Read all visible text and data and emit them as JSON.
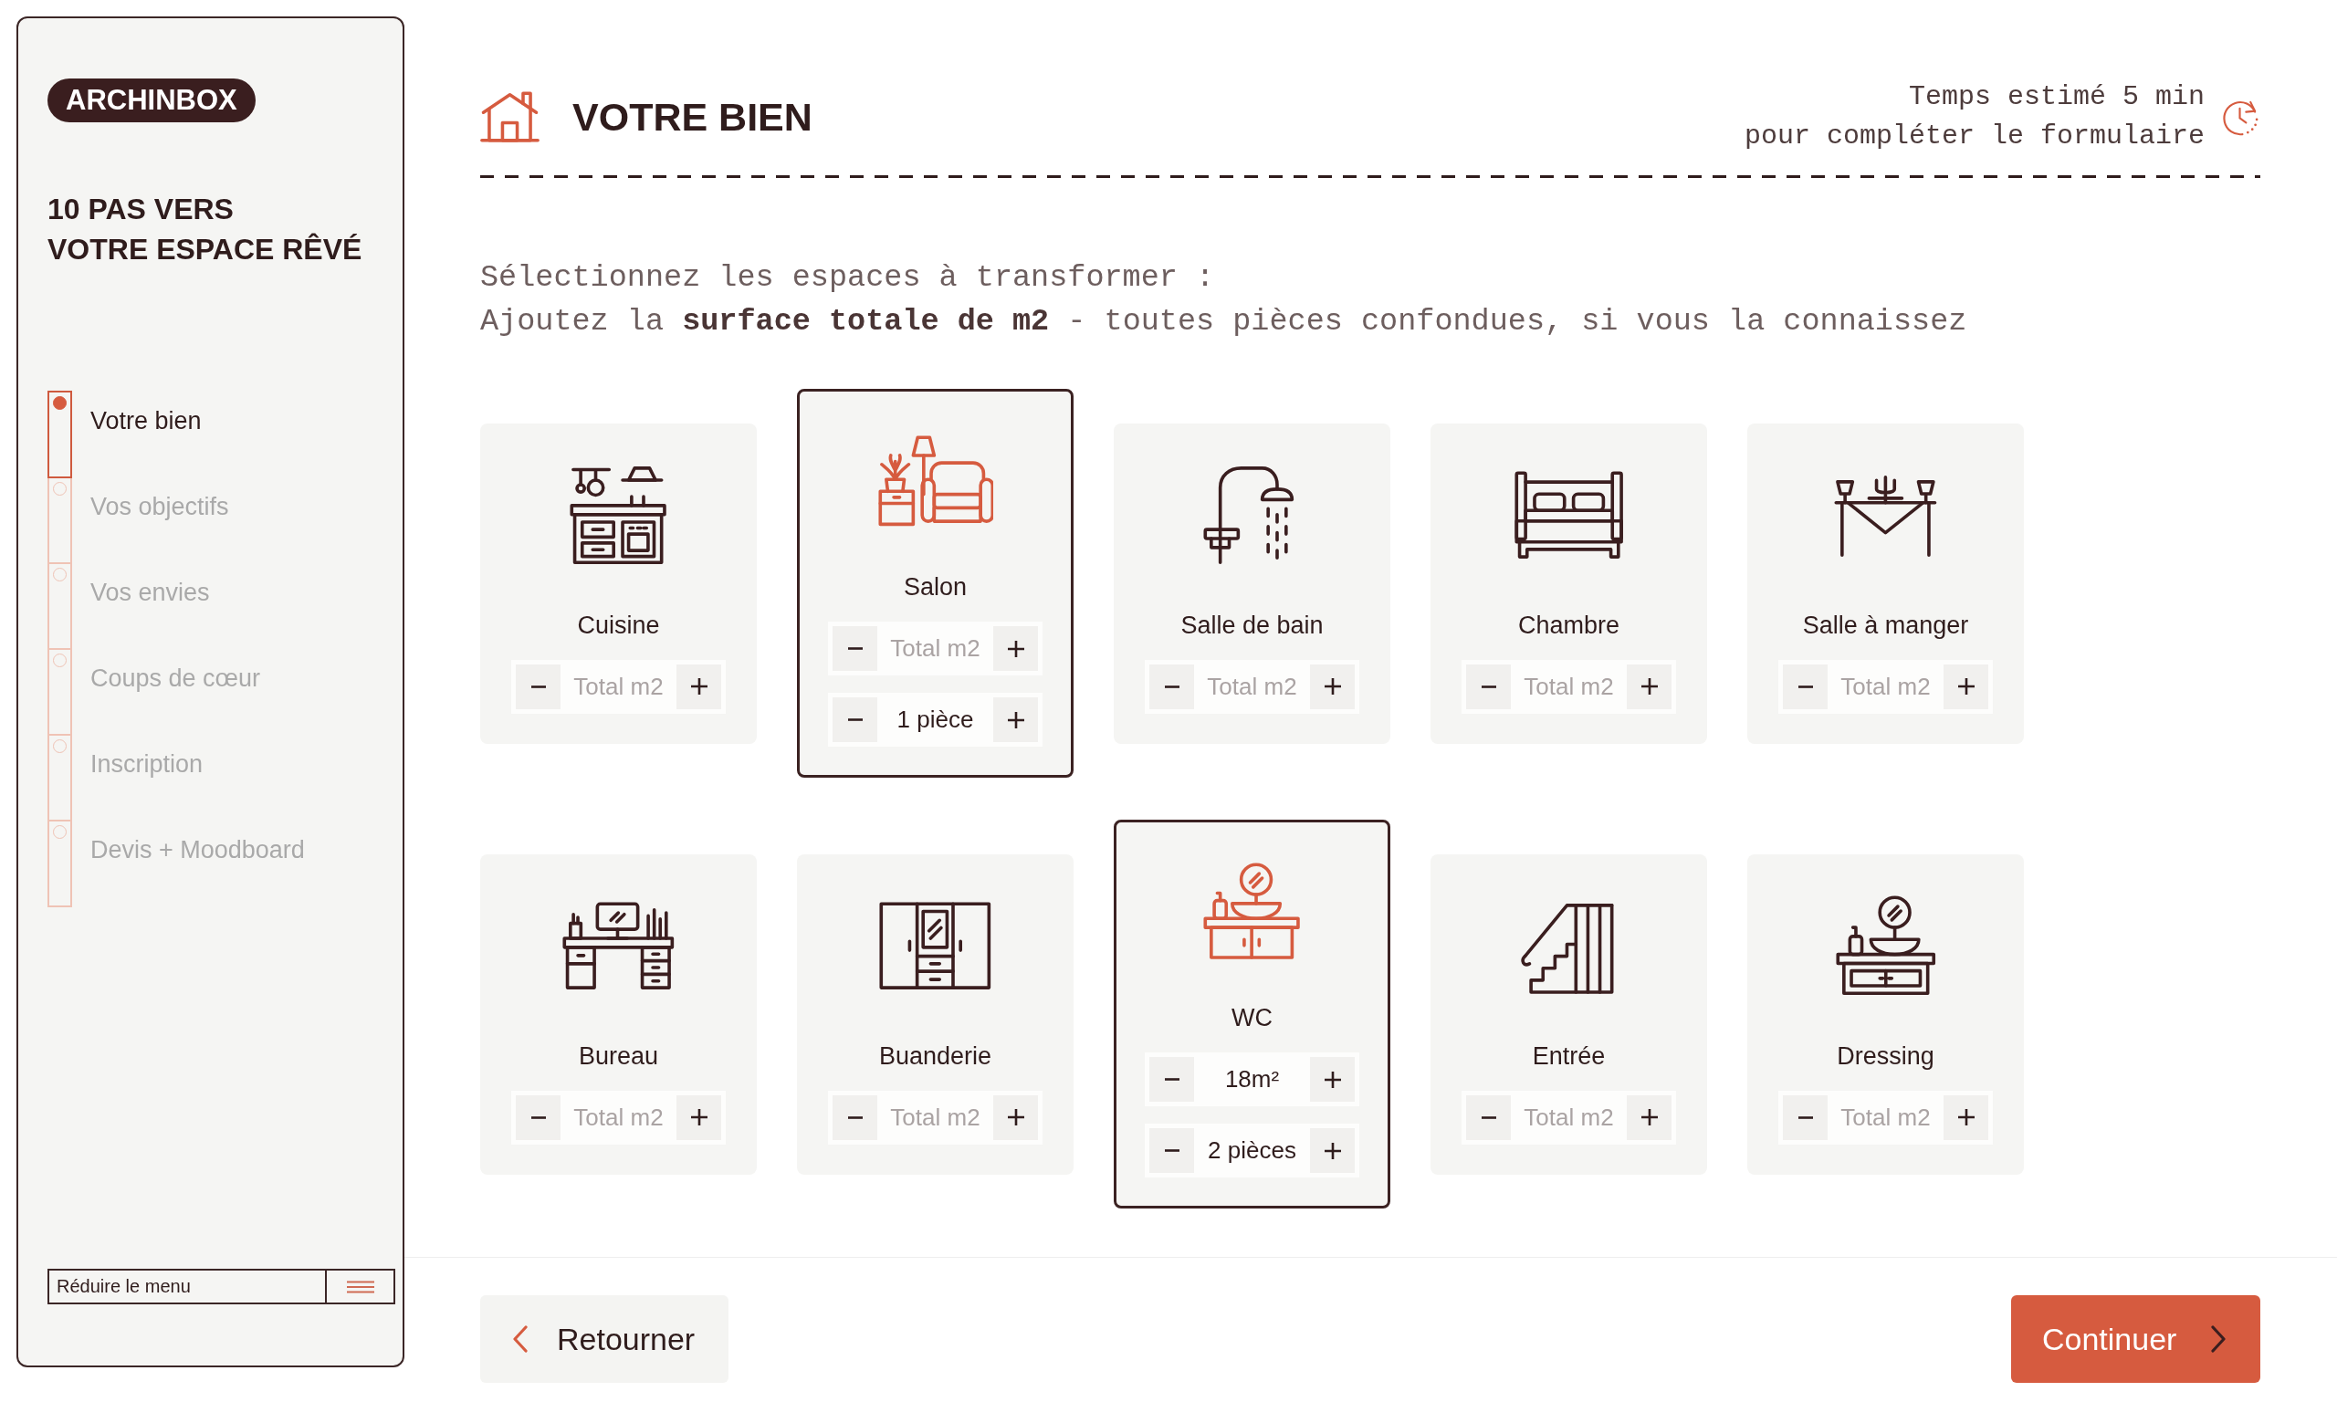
{
  "sidebar": {
    "logo": "ARCHINBOX",
    "heading_lines": [
      "10 PAS VERS",
      "VOTRE ESPACE RÊVÉ"
    ],
    "steps": [
      {
        "label": "Votre bien",
        "selected": true
      },
      {
        "label": "Vos objectifs",
        "selected": false
      },
      {
        "label": "Vos envies",
        "selected": false
      },
      {
        "label": "Coups de cœur",
        "selected": false
      },
      {
        "label": "Inscription",
        "selected": false
      },
      {
        "label": "Devis + Moodboard",
        "selected": false
      }
    ],
    "collapse_button": "Réduire le menu"
  },
  "header": {
    "title": "VOTRE BIEN",
    "time_note": [
      "Temps estimé 5 min",
      "pour compléter le formulaire"
    ]
  },
  "instructions": [
    "Sélectionnez les espaces à transformer :",
    "Ajoutez la **surface totale de m2** - toutes pièces confondues, si vous la connaissez"
  ],
  "rooms": [
    {
      "name": "Cuisine",
      "kind": "kitchen",
      "selected": false,
      "fields": [
        {
          "placeholder": "Total m2"
        }
      ]
    },
    {
      "name": "Salon",
      "kind": "living",
      "selected": true,
      "fields": [
        {
          "placeholder": "Total m2"
        },
        {
          "value": "1 pièce"
        }
      ]
    },
    {
      "name": "Salle de bain",
      "kind": "bathroom",
      "selected": false,
      "fields": [
        {
          "placeholder": "Total m2"
        }
      ]
    },
    {
      "name": "Chambre",
      "kind": "bedroom",
      "selected": false,
      "fields": [
        {
          "placeholder": "Total m2"
        }
      ]
    },
    {
      "name": "Salle à manger",
      "kind": "dining",
      "selected": false,
      "fields": [
        {
          "placeholder": "Total m2"
        }
      ]
    },
    {
      "name": "Bureau",
      "kind": "office",
      "selected": false,
      "fields": [
        {
          "placeholder": "Total m2"
        }
      ]
    },
    {
      "name": "Buanderie",
      "kind": "laundry",
      "selected": false,
      "fields": [
        {
          "placeholder": "Total m2"
        }
      ]
    },
    {
      "name": "WC",
      "kind": "wc",
      "selected": true,
      "fields": [
        {
          "value": "18m²"
        },
        {
          "value": "2 pièces"
        }
      ]
    },
    {
      "name": "Entrée",
      "kind": "entrance",
      "selected": false,
      "fields": [
        {
          "placeholder": "Total m2"
        }
      ]
    },
    {
      "name": "Dressing",
      "kind": "dressing",
      "selected": false,
      "fields": [
        {
          "placeholder": "Total m2"
        }
      ]
    }
  ],
  "footer": {
    "back_button": "Retourner",
    "continue_button": "Continuer"
  }
}
